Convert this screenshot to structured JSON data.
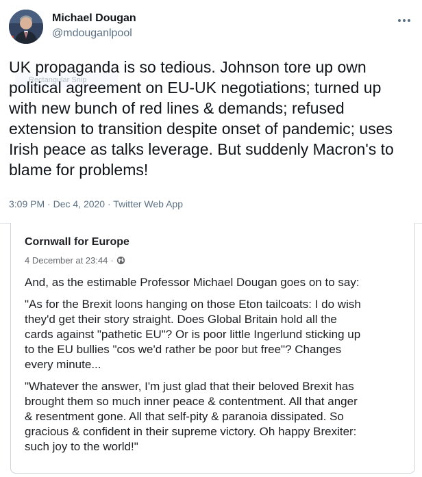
{
  "tweet": {
    "author_name": "Michael Dougan",
    "author_handle": "@mdouganlpool",
    "text_lines": [
      "UK propaganda is so tedious. Johnson tore up own",
      "political agreement on EU-UK negotiations; turned up",
      "with new bunch of red lines & demands; refused",
      "extension to transition despite onset of pandemic; uses",
      "Irish peace as talks leverage. But suddenly Macron's to",
      "blame for problems!"
    ],
    "time": "3:09 PM",
    "date": "Dec 4, 2020",
    "client": "Twitter Web App",
    "separator": " · ",
    "watermark": "Rectangular Snip",
    "icons": {
      "more": "more-dots-icon",
      "avatar": "avatar"
    },
    "colors": {
      "text": "#0f1419",
      "secondary": "#5b7083"
    }
  },
  "facebook_post": {
    "page_name": "Cornwall for Europe",
    "date": "4 December at 23:44",
    "date_separator": " · ",
    "icons": {
      "privacy": "globe-icon"
    },
    "paragraphs": [
      {
        "lines": [
          "And, as the estimable Professor Michael Dougan goes on to say:"
        ]
      },
      {
        "lines": [
          "\"As for the Brexit loons hanging on those Eton tailcoats: I do wish",
          "they'd get their story straight. Does Global Britain hold all the",
          "cards against \"pathetic EU\"? Or is poor little Ingerlund sticking up",
          "to the EU bullies \"cos we'd rather be poor but free\"? Changes",
          "every minute..."
        ]
      },
      {
        "lines": [
          "\"Whatever the answer, I'm just glad that their beloved Brexit has",
          "brought them so much inner peace & contentment. All that anger",
          "& resentment gone. All that self-pity & paranoia dissipated. So",
          "gracious & confident in their supreme victory. Oh happy Brexiter:",
          "such joy to the world!\""
        ]
      }
    ]
  }
}
